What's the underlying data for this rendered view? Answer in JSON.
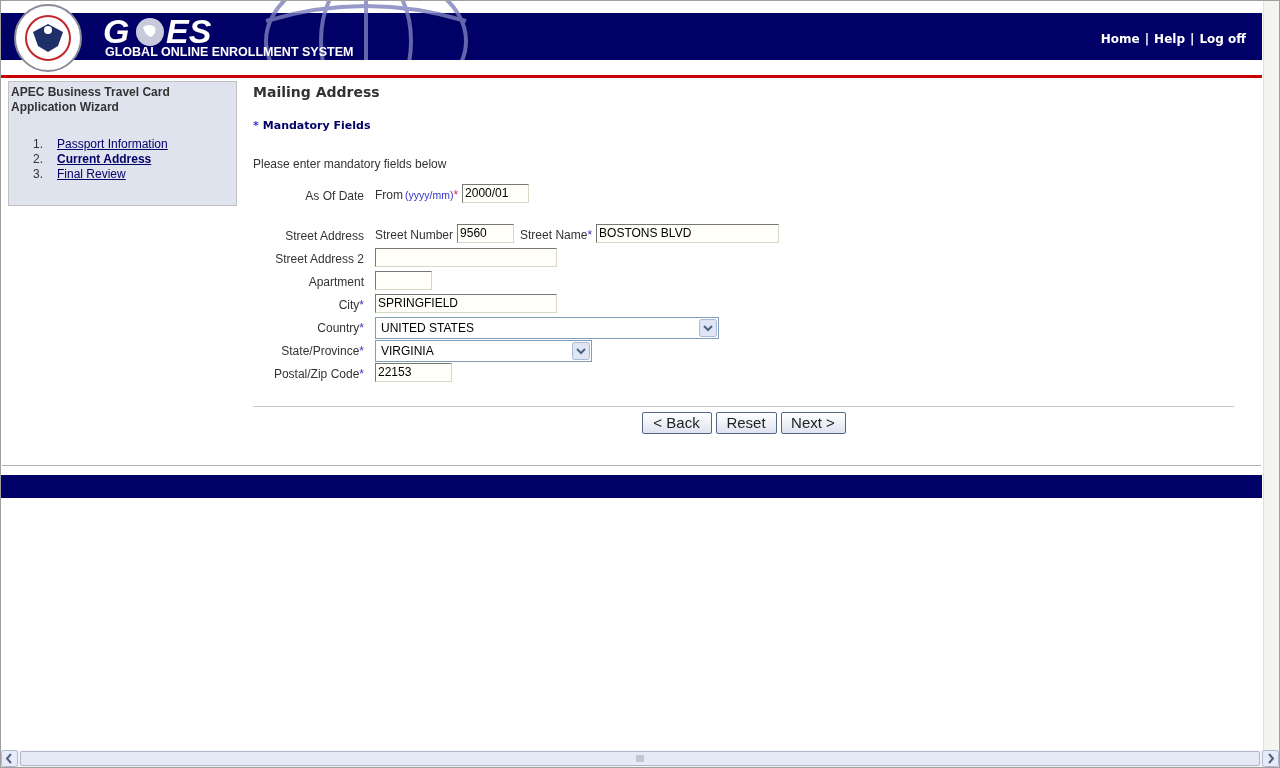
{
  "header": {
    "logo_left": "G",
    "logo_right": "ES",
    "logo_subtitle": "GLOBAL ONLINE ENROLLMENT SYSTEM",
    "links": [
      "Home",
      "Help",
      "Log off"
    ],
    "separator": "|"
  },
  "sidebar": {
    "title": "APEC Business Travel Card Application Wizard",
    "steps": [
      {
        "number": "1.",
        "label": "Passport Information",
        "selected": false
      },
      {
        "number": "2.",
        "label": "Current Address",
        "selected": true
      },
      {
        "number": "3.",
        "label": "Final Review",
        "selected": false
      }
    ]
  },
  "main": {
    "heading": "Mailing Address",
    "mandatory_note": {
      "marker": "*",
      "text": "Mandatory Fields"
    },
    "instructions": "Please enter mandatory fields below",
    "rows": [
      {
        "label": "As Of Date",
        "controls": [
          {
            "kind": "text",
            "text": "From"
          },
          {
            "kind": "hint",
            "text": "(yyyy/mm)",
            "marker": "*"
          },
          {
            "kind": "input",
            "value": "2000/01"
          }
        ]
      },
      {
        "label": "Street Address",
        "controls": [
          {
            "kind": "text",
            "text": "Street Number"
          },
          {
            "kind": "input",
            "value": "9560"
          },
          {
            "kind": "text",
            "text": "Street Name",
            "marker": "*"
          },
          {
            "kind": "input",
            "value": "BOSTONS BLVD"
          }
        ]
      },
      {
        "label": "Street Address 2",
        "controls": [
          {
            "kind": "input"
          }
        ]
      },
      {
        "label": "Apartment",
        "controls": [
          {
            "kind": "input"
          }
        ]
      },
      {
        "label": "City",
        "marker": "*",
        "controls": [
          {
            "kind": "input",
            "value": "SPRINGFIELD"
          }
        ]
      },
      {
        "label": "Country",
        "marker": "*",
        "controls": [
          {
            "kind": "select",
            "value": "UNITED STATES"
          }
        ]
      },
      {
        "label": "State/Province",
        "marker": "*",
        "controls": [
          {
            "kind": "select",
            "value": "VIRGINIA"
          }
        ]
      },
      {
        "label": "Postal/Zip Code",
        "marker": "*",
        "controls": [
          {
            "kind": "input",
            "value": "22153"
          }
        ]
      }
    ],
    "buttons": [
      "< Back",
      "Reset",
      "Next >"
    ]
  }
}
